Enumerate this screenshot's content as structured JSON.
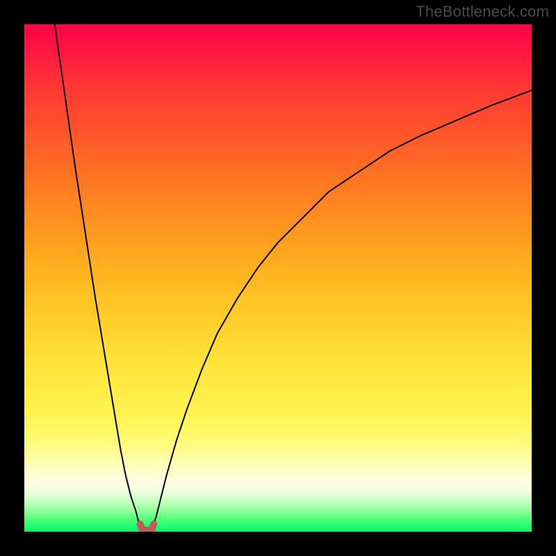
{
  "watermark": "TheBottleneck.com",
  "chart_data": {
    "type": "line",
    "title": "",
    "xlabel": "",
    "ylabel": "",
    "xlim": [
      0,
      100
    ],
    "ylim": [
      0,
      100
    ],
    "grid": false,
    "legend": false,
    "background_gradient": {
      "direction": "vertical",
      "stops": [
        {
          "pos": 0.0,
          "color": "#ff004a"
        },
        {
          "pos": 0.5,
          "color": "#ffb01f"
        },
        {
          "pos": 0.8,
          "color": "#fffc80"
        },
        {
          "pos": 0.92,
          "color": "#f0ffe2"
        },
        {
          "pos": 1.0,
          "color": "#05f85f"
        }
      ]
    },
    "series": [
      {
        "name": "bottleneck-curve-left",
        "color": "#000000",
        "stroke_width": 2,
        "x": [
          6,
          8,
          10,
          12,
          14,
          16,
          18,
          19,
          20,
          21,
          22,
          22.5,
          22.8
        ],
        "y": [
          100,
          86,
          72,
          59,
          46,
          34,
          22,
          16,
          11,
          7,
          4,
          2,
          1.5
        ]
      },
      {
        "name": "bottleneck-curve-right",
        "color": "#000000",
        "stroke_width": 2,
        "x": [
          25.5,
          26,
          27,
          28,
          30,
          32,
          35,
          38,
          42,
          46,
          50,
          55,
          60,
          66,
          72,
          78,
          85,
          92,
          100
        ],
        "y": [
          1.5,
          3,
          7,
          11,
          18,
          24,
          32,
          39,
          46,
          52,
          57,
          62,
          67,
          71,
          75,
          78,
          81,
          84,
          87
        ]
      },
      {
        "name": "bottleneck-marker",
        "color": "#c25a5a",
        "stroke_width": 10,
        "x": [
          22.8,
          23.2,
          23.7,
          24.2,
          24.7,
          25.2,
          25.5
        ],
        "y": [
          1.5,
          0.6,
          0.3,
          0.3,
          0.3,
          0.6,
          1.5
        ]
      }
    ]
  }
}
